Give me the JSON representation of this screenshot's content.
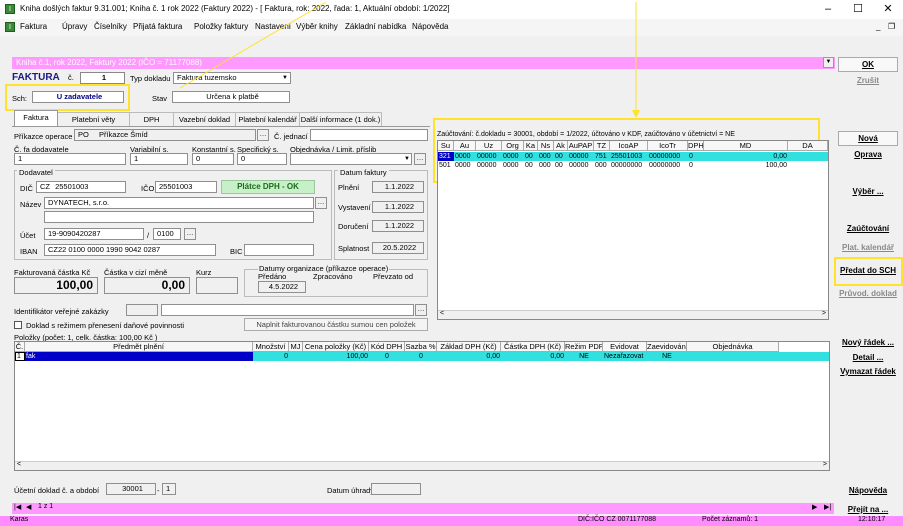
{
  "window": {
    "title": "Kniha došlých faktur 9.31.001; Kniha č. 1 rok 2022 (Faktury 2022) - [ Faktura, rok: 2022, řada: 1, Aktuální období: 1/2022]",
    "min": "–",
    "max": "☐",
    "close": "✕",
    "sub_min": "_",
    "sub_restore": "❐"
  },
  "menu": [
    "Faktura",
    "Úpravy",
    "Číselníky",
    "Přijatá faktura",
    "Položky faktury",
    "Nastavení",
    "Výběr knihy",
    "Základní nabídka",
    "Nápověda"
  ],
  "book_select": "Kniha č.1, rok 2022, Faktury 2022 (IČO = 71177088)",
  "header": {
    "faktura_label": "FAKTURA",
    "cislo_label": "č.",
    "cislo": "1",
    "typ_label": "Typ dokladu",
    "typ": "Faktura tuzemsko",
    "sch_label": "Sch:",
    "sch_value": "U zadavatele",
    "stav_label": "Stav",
    "stav_value": "Určena k platbě"
  },
  "tabs": [
    "Faktura",
    "Platební věty",
    "DPH",
    "Vazební doklad",
    "Platební kalendář",
    "Další informace (1 dok.)"
  ],
  "form": {
    "prikazce_label": "Příkazce operace",
    "prikazce_code": "PO",
    "prikazce_name": "Příkazce Šmíd",
    "jednaci_label": "Č. jednací",
    "cfa_label": "Č. fa dodavatele",
    "cfa": "1",
    "vs_label": "Variabilní s.",
    "vs": "1",
    "ks_label": "Konstantní s.",
    "ks": "0",
    "ss_label": "Specifický s.",
    "ss": "0",
    "objednavka_label": "Objednávka / Limit. příslib",
    "dodavatel_label": "Dodavatel",
    "dic_label": "DIČ",
    "dic_cc": "CZ",
    "dic": "25501003",
    "ico_label": "IČO",
    "ico": "25501003",
    "platce": "Plátce DPH - OK",
    "nazev_label": "Název",
    "nazev": "DYNATECH, s.r.o.",
    "ucet_label": "Účet",
    "ucet": "19-9090420287",
    "banka": "0100",
    "iban_label": "IBAN",
    "iban": "CZ22 0100 0000 1990 9042 0287",
    "bic_label": "BIC",
    "datum_faktury_label": "Datum faktury",
    "plneni_label": "Plnění",
    "plneni": "1.1.2022",
    "vystaveni_label": "Vystavení",
    "vystaveni": "1.1.2022",
    "doruceni_label": "Doručení",
    "doruceni": "1.1.2022",
    "splatnost_label": "Splatnost",
    "splatnost": "20.5.2022",
    "fakt_castka_label": "Fakturovaná částka Kč",
    "fakt_castka": "100,00",
    "cizi_castka_label": "Částka v cizí měně",
    "cizi_castka": "0,00",
    "kurz_label": "Kurz",
    "datumy_label": "Datumy organizace (příkazce operace)",
    "predano_label": "Předáno",
    "zpracovano_label": "Zpracováno",
    "prevzato_label": "Převzato od",
    "predano": "4.5.2022",
    "identifikator_label": "Identifikátor veřejné zakázky",
    "rezim_label": "Doklad s režimem přenesení daňové povinnosti",
    "naplnit_button": "Naplnit fakturovanou částku sumou cen položek"
  },
  "ledger": {
    "caption": "Zaúčtování: č.dokladu = 30001, období = 1/2022, účtováno v KDF, zaúčtováno v účetnictví = NE",
    "headers": [
      "Su",
      "Au",
      "Uz",
      "Org",
      "Ka",
      "Ns",
      "Ak",
      "AuPAP",
      "TZ",
      "IcoAP",
      "IcoTr",
      "DPH",
      "MD",
      "DA"
    ],
    "rows": [
      [
        "321",
        "0000",
        "00000",
        "0000",
        "00",
        "000",
        "00",
        "00000",
        "751",
        "25501003",
        "00000000",
        "0",
        "0,00",
        ""
      ],
      [
        "501",
        "0000",
        "00000",
        "0000",
        "00",
        "000",
        "00",
        "00000",
        "000",
        "00000000",
        "00000000",
        "0",
        "100,00",
        ""
      ]
    ]
  },
  "items": {
    "caption": "Položky (počet: 1, celk. částka: 100,00 Kč )",
    "headers": [
      "Č.",
      "Předmět plnění",
      "Množství",
      "MJ",
      "Cena položky (Kč)",
      "Kód DPH",
      "Sazba %",
      "Základ DPH (Kč)",
      "Částka DPH (Kč)",
      "Režim PDP",
      "Evidovat",
      "Zaevidováno",
      "Objednávka"
    ],
    "rows": [
      [
        "1",
        "fak",
        "0",
        "",
        "100,00",
        "0",
        "0",
        "0,00",
        "0,00",
        "NE",
        "Nezařazovat",
        "NE",
        ""
      ]
    ]
  },
  "bottom": {
    "ucetni_label": "Účetní doklad č. a období",
    "ucetni": "30001",
    "obdobi": "1",
    "datum_uhrady_label": "Datum úhrady",
    "nav_first": "|◀",
    "nav_prev": "◀",
    "nav_pos": "1 z 1",
    "nav_next": "▶",
    "nav_last": "▶|"
  },
  "buttons": {
    "ok": "OK",
    "zrusit": "Zrušit",
    "nova": "Nová",
    "oprava": "Oprava",
    "vyber": "Výběr ...",
    "zauctovani": "Zaúčtování",
    "plat_kalendar": "Plat. kalendář",
    "predat": "Předat do SCH",
    "provod": "Průvod. doklad",
    "novy_radek": "Nový řádek ...",
    "detail": "Detail ...",
    "vymazat": "Vymazat řádek",
    "napoveda": "Nápověda",
    "prejit": "Přejít na ..."
  },
  "status": {
    "left": "Karas",
    "dic": "DIČ:IČO CZ 0071177088",
    "pocet": "Počet záznamů: 1",
    "time": "12:10:17"
  }
}
